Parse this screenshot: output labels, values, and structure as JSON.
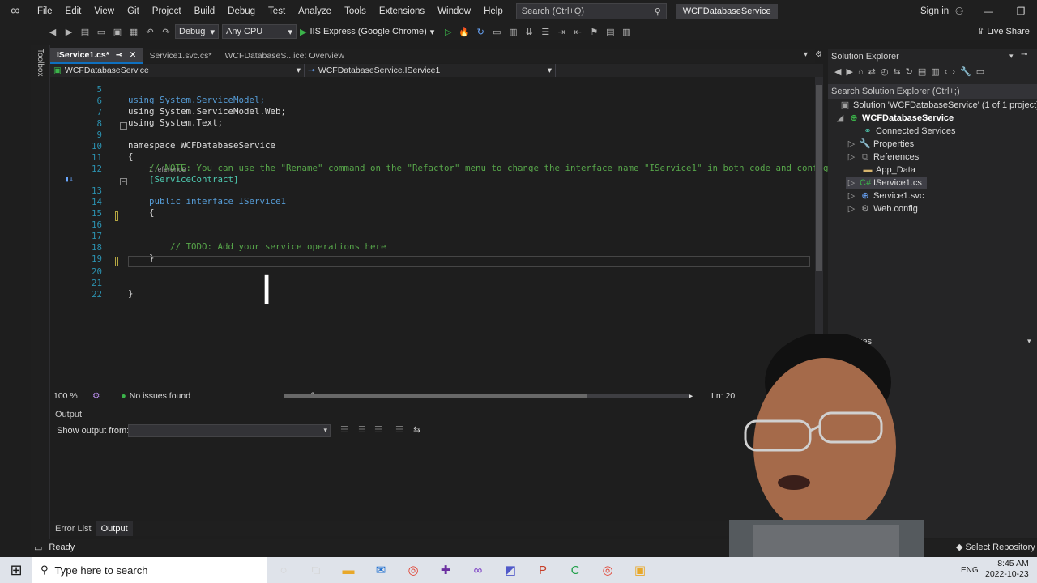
{
  "menubar": {
    "items": [
      "File",
      "Edit",
      "View",
      "Git",
      "Project",
      "Build",
      "Debug",
      "Test",
      "Analyze",
      "Tools",
      "Extensions",
      "Window",
      "Help"
    ],
    "search_placeholder": "Search (Ctrl+Q)",
    "solution_name": "WCFDatabaseService",
    "signin": "Sign in"
  },
  "toolbar": {
    "config": "Debug",
    "platform": "Any CPU",
    "run_target": "IIS Express (Google Chrome)",
    "live_share": "Live Share"
  },
  "toolbox_label": "Toolbox",
  "editor": {
    "tabs": [
      {
        "label": "IService1.cs*",
        "active": true
      },
      {
        "label": "Service1.svc.cs*",
        "active": false
      },
      {
        "label": "WCFDatabaseS...ice: Overview",
        "active": false
      }
    ],
    "nav_project": "WCFDatabaseService",
    "nav_type": "WCFDatabaseService.IService1",
    "lines": [
      {
        "n": "5",
        "text": "using System.ServiceModel;"
      },
      {
        "n": "6",
        "text": "using System.ServiceModel.Web;"
      },
      {
        "n": "7",
        "text": "using System.Text;"
      },
      {
        "n": "8",
        "text": ""
      },
      {
        "n": "9",
        "text": "namespace WCFDatabaseService"
      },
      {
        "n": "10",
        "text": "{"
      },
      {
        "n": "11",
        "text": "    // NOTE: You can use the \"Rename\" command on the \"Refactor\" menu to change the interface name \"IService1\" in both code and config"
      },
      {
        "n": "12",
        "text": "    [ServiceContract]"
      },
      {
        "n": "13",
        "text": "    public interface IService1"
      },
      {
        "n": "14",
        "text": "    {"
      },
      {
        "n": "15",
        "text": ""
      },
      {
        "n": "16",
        "text": ""
      },
      {
        "n": "17",
        "text": "        // TODO: Add your service operations here"
      },
      {
        "n": "18",
        "text": "    }"
      },
      {
        "n": "19",
        "text": ""
      },
      {
        "n": "20",
        "text": ""
      },
      {
        "n": "21",
        "text": "}"
      },
      {
        "n": "22",
        "text": ""
      }
    ],
    "codelens": "1 reference",
    "zoom": "100 %",
    "issues": "No issues found",
    "position": "Ln: 20"
  },
  "output": {
    "title": "Output",
    "show_from": "Show output from:"
  },
  "bottom_tabs": [
    "Error List",
    "Output"
  ],
  "solution_explorer": {
    "title": "Solution Explorer",
    "search_placeholder": "Search Solution Explorer (Ctrl+;)",
    "items": [
      {
        "label": "Solution 'WCFDatabaseService' (1 of 1 project)"
      },
      {
        "label": "WCFDatabaseService"
      },
      {
        "label": "Connected Services"
      },
      {
        "label": "Properties"
      },
      {
        "label": "References"
      },
      {
        "label": "App_Data"
      },
      {
        "label": "IService1.cs"
      },
      {
        "label": "Service1.svc"
      },
      {
        "label": "Web.config"
      }
    ]
  },
  "properties": {
    "title": "Properties"
  },
  "statusbar": {
    "ready": "Ready",
    "select_repo": "Select Repository"
  },
  "taskbar": {
    "search_placeholder": "Type here to search",
    "lang": "ENG",
    "time": "8:45 AM",
    "date": "2022-10-23"
  }
}
